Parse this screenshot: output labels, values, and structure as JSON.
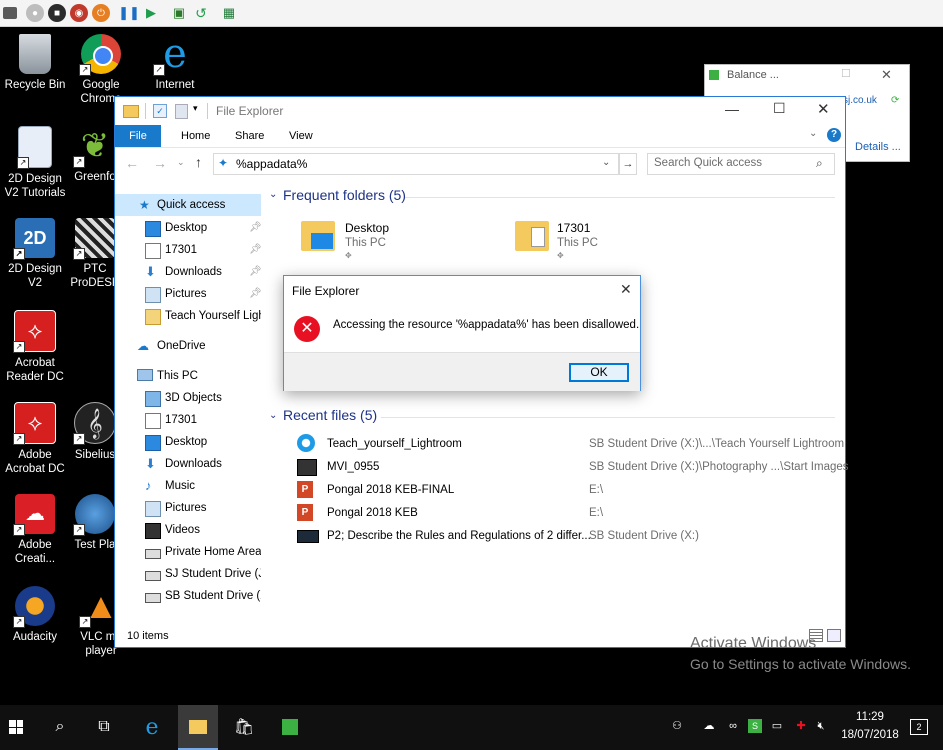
{
  "desktop": {
    "icons": [
      {
        "label": "Recycle Bin"
      },
      {
        "label": "Google Chrome"
      },
      {
        "label": "Internet"
      },
      {
        "label": "2D Design V2 Tutorials"
      },
      {
        "label": "Greenfo"
      },
      {
        "label": "2D Design V2"
      },
      {
        "label": "PTC ProDESK"
      },
      {
        "label": "Acrobat Reader DC"
      },
      {
        "label": "Adobe Acrobat DC"
      },
      {
        "label": "Sibelius"
      },
      {
        "label": "Adobe Creati..."
      },
      {
        "label": "Test Pla"
      },
      {
        "label": "Audacity"
      },
      {
        "label": "VLC me player"
      }
    ]
  },
  "balance_window": {
    "title": "Balance ...",
    "url_fragment": "sj.co.uk",
    "details_link": "Details ..."
  },
  "explorer": {
    "title": "File Explorer",
    "tabs": [
      "File",
      "Home",
      "Share",
      "View"
    ],
    "address": "%appadata%",
    "search_placeholder": "Search Quick access",
    "nav": {
      "quick_access": "Quick access",
      "quick_items": [
        "Desktop",
        "17301",
        "Downloads",
        "Pictures",
        "Teach Yourself Ligh"
      ],
      "onedrive": "OneDrive",
      "this_pc": "This PC",
      "pc_items": [
        "3D Objects",
        "17301",
        "Desktop",
        "Downloads",
        "Music",
        "Pictures",
        "Videos",
        "Private Home Area",
        "SJ Student Drive (J:)",
        "SB Student Drive (X:"
      ]
    },
    "frequent": {
      "header": "Frequent folders (5)",
      "folders": [
        {
          "name": "Desktop",
          "location": "This PC"
        },
        {
          "name": "17301",
          "location": "This PC"
        }
      ]
    },
    "recent": {
      "header": "Recent files (5)",
      "files": [
        {
          "name": "Teach_yourself_Lightroom",
          "path": "SB Student Drive (X:)\\...\\Teach Yourself Lightroom"
        },
        {
          "name": "MVI_0955",
          "path": "SB Student Drive (X:)\\Photography ...\\Start Images"
        },
        {
          "name": "Pongal 2018 KEB-FINAL",
          "path": "E:\\"
        },
        {
          "name": "Pongal 2018 KEB",
          "path": "E:\\"
        },
        {
          "name": "P2; Describe the Rules and Regulations of 2 differ...",
          "path": "SB Student Drive (X:)"
        }
      ]
    },
    "status": "10 items"
  },
  "dialog": {
    "title": "File Explorer",
    "message": "Accessing the resource '%appadata%' has been disallowed.",
    "ok": "OK"
  },
  "watermark": {
    "line1": "Activate Windows",
    "line2": "Go to Settings to activate Windows."
  },
  "taskbar": {
    "time": "11:29",
    "date": "18/07/2018"
  },
  "colors": {
    "accent": "#1979ca",
    "error": "#e81123",
    "folder": "#f4c95d"
  }
}
